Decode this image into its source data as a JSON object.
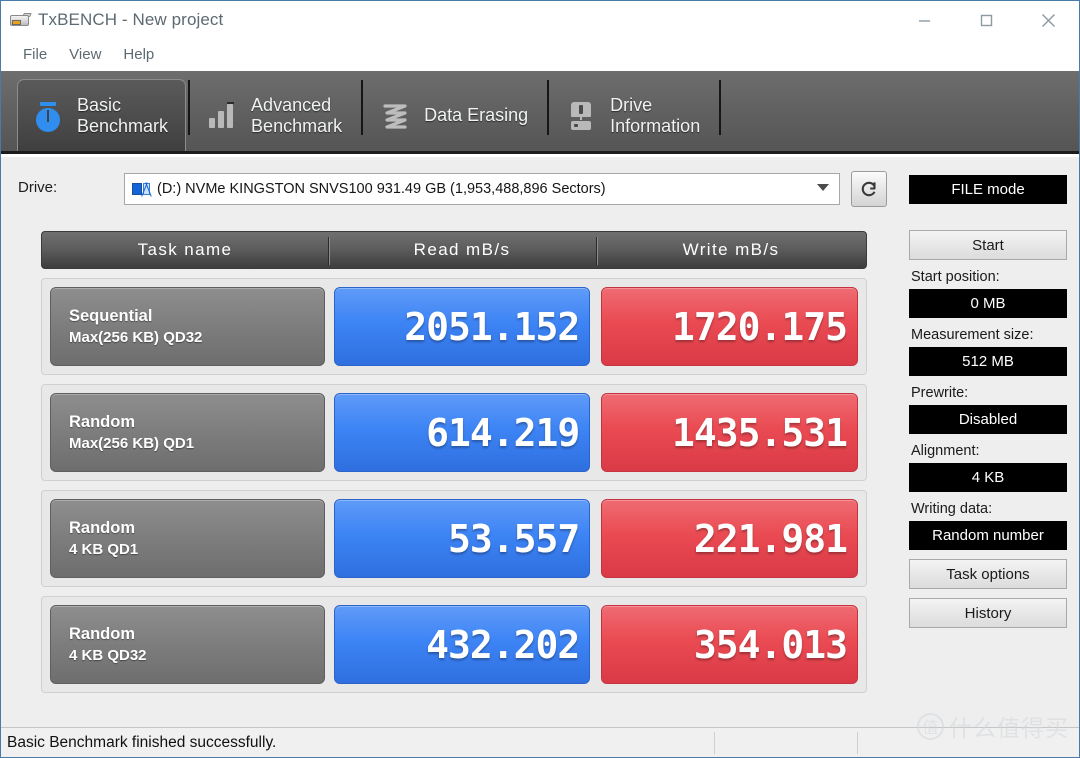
{
  "window": {
    "title": "TxBENCH - New project",
    "icon": "app-icon",
    "controls": [
      {
        "name": "minimize-button",
        "glyph": "minimize-icon"
      },
      {
        "name": "maximize-button",
        "glyph": "maximize-icon"
      },
      {
        "name": "close-button",
        "glyph": "close-icon"
      }
    ]
  },
  "menu": {
    "items": [
      {
        "label": "File"
      },
      {
        "label": "View"
      },
      {
        "label": "Help"
      }
    ]
  },
  "tabs": [
    {
      "label": "Basic\nBenchmark",
      "icon": "stopwatch-icon",
      "active": true
    },
    {
      "label": "Advanced\nBenchmark",
      "icon": "bar-chart-icon",
      "active": false
    },
    {
      "label": "Data Erasing",
      "icon": "erase-icon",
      "active": false
    },
    {
      "label": "Drive\nInformation",
      "icon": "drive-info-icon",
      "active": false
    }
  ],
  "drive": {
    "label": "Drive:",
    "selected": "(D:) NVMe KINGSTON SNVS100  931.49 GB (1,953,488,896 Sectors)",
    "icon": "disk-partition-icon",
    "dropdown_icon": "chevron-down-icon",
    "refresh_icon": "refresh-icon"
  },
  "results": {
    "columns": [
      "Task name",
      "Read mB/s",
      "Write mB/s"
    ],
    "rows": [
      {
        "task_line1": "Sequential",
        "task_line2": "Max(256 KB) QD32",
        "read": "2051.152",
        "write": "1720.175"
      },
      {
        "task_line1": "Random",
        "task_line2": "Max(256 KB) QD1",
        "read": "614.219",
        "write": "1435.531"
      },
      {
        "task_line1": "Random",
        "task_line2": "4 KB QD1",
        "read": "53.557",
        "write": "221.981"
      },
      {
        "task_line1": "Random",
        "task_line2": "4 KB QD32",
        "read": "432.202",
        "write": "354.013"
      }
    ]
  },
  "sidebar": {
    "mode_button": "FILE mode",
    "start_button": "Start",
    "start_position_label": "Start position:",
    "start_position_value": "0 MB",
    "measurement_size_label": "Measurement size:",
    "measurement_size_value": "512 MB",
    "prewrite_label": "Prewrite:",
    "prewrite_value": "Disabled",
    "alignment_label": "Alignment:",
    "alignment_value": "4 KB",
    "writing_data_label": "Writing data:",
    "writing_data_value": "Random number",
    "task_options_button": "Task options",
    "history_button": "History"
  },
  "status": {
    "message": "Basic Benchmark finished successfully."
  },
  "watermark": {
    "badge": "值",
    "text": "什么值得买"
  },
  "colors": {
    "read_accent": "#3d84f5",
    "write_accent": "#ea4a52",
    "tab_bar": "#636363",
    "task_button": "#7d7d7d",
    "panel_bg": "#eeeeee",
    "value_field_bg": "#000000"
  }
}
